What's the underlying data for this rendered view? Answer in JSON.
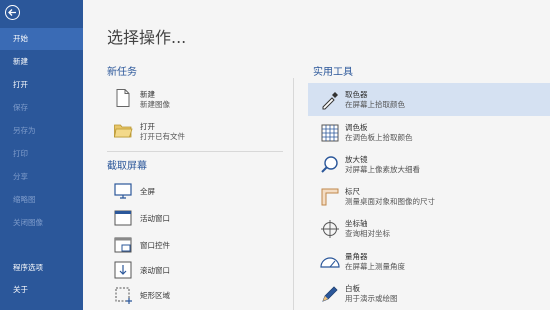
{
  "sidebar": {
    "items": [
      {
        "label": "开始",
        "state": "active"
      },
      {
        "label": "新建",
        "state": "normal"
      },
      {
        "label": "打开",
        "state": "normal"
      },
      {
        "label": "保存",
        "state": "disabled"
      },
      {
        "label": "另存为",
        "state": "disabled"
      },
      {
        "label": "打印",
        "state": "disabled"
      },
      {
        "label": "分享",
        "state": "disabled"
      },
      {
        "label": "缩略图",
        "state": "disabled"
      },
      {
        "label": "关闭图像",
        "state": "disabled"
      }
    ],
    "bottom": [
      {
        "label": "程序选项"
      },
      {
        "label": "关于"
      }
    ]
  },
  "main": {
    "title": "选择操作...",
    "new_task": {
      "heading": "新任务",
      "items": [
        {
          "label": "新建",
          "desc": "新建图像",
          "icon": "new-document-icon"
        },
        {
          "label": "打开",
          "desc": "打开已有文件",
          "icon": "open-folder-icon"
        }
      ]
    },
    "capture": {
      "heading": "截取屏幕",
      "items": [
        {
          "label": "全屏",
          "icon": "monitor-icon"
        },
        {
          "label": "活动窗口",
          "icon": "window-icon"
        },
        {
          "label": "窗口控件",
          "icon": "window-control-icon"
        },
        {
          "label": "滚动窗口",
          "icon": "scroll-window-icon"
        },
        {
          "label": "矩形区域",
          "icon": "rectangle-region-icon"
        }
      ]
    },
    "tools": {
      "heading": "实用工具",
      "items": [
        {
          "label": "取色器",
          "desc": "在屏幕上拾取颜色",
          "icon": "eyedropper-icon"
        },
        {
          "label": "调色板",
          "desc": "在调色板上拾取颜色",
          "icon": "palette-icon"
        },
        {
          "label": "放大镜",
          "desc": "对屏幕上像素放大细看",
          "icon": "magnifier-icon"
        },
        {
          "label": "标尺",
          "desc": "测量桌面对象和图像的尺寸",
          "icon": "ruler-icon"
        },
        {
          "label": "坐标轴",
          "desc": "查询相对坐标",
          "icon": "crosshair-icon"
        },
        {
          "label": "量角器",
          "desc": "在屏幕上测量角度",
          "icon": "protractor-icon"
        },
        {
          "label": "白板",
          "desc": "用于演示或绘图",
          "icon": "whiteboard-pen-icon"
        }
      ]
    }
  },
  "colors": {
    "sidebar": "#2b579a",
    "sidebar_active": "#3a6bb5",
    "accent": "#2b579a",
    "highlight": "#d5e1f2"
  }
}
